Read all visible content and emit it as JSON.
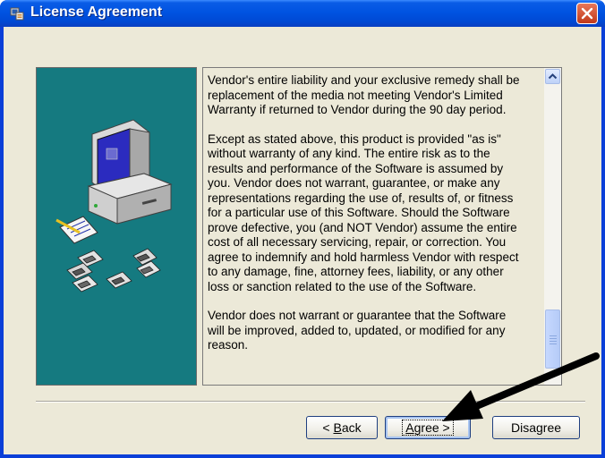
{
  "window": {
    "title": "License Agreement"
  },
  "license": {
    "paragraphs": [
      "Vendor's entire liability and your exclusive remedy shall be\nreplacement of the media not meeting Vendor's Limited\nWarranty if returned to Vendor during the 90 day period.",
      "Except as stated above, this product is provided \"as is\"\nwithout warranty of any kind.  The entire risk as to the\nresults and performance of the Software is assumed by\nyou.  Vendor does not warrant, guarantee, or make any\nrepresentations regarding the use of, results of, or fitness\nfor a particular use of this Software.  Should the Software\nprove defective, you (and NOT Vendor) assume the entire\ncost of all necessary servicing, repair, or correction.  You\nagree to indemnify and hold harmless Vendor with respect\nto any damage, fine, attorney fees, liability, or any other\nloss or sanction related to the use of the Software.",
      "Vendor does not warrant or guarantee that the Software\nwill be improved, added to, updated, or modified for any\nreason."
    ]
  },
  "buttons": {
    "back": {
      "prefix": "< ",
      "mnemonic": "B",
      "rest": "ack"
    },
    "agree": {
      "mnemonic": "A",
      "rest": "gree >"
    },
    "disagree": "Disagree"
  },
  "icons": {
    "title": "setup-icon",
    "close": "close-icon",
    "scroll_up": "chevron-up-icon",
    "illustration": "computer-with-disks-illustration",
    "annotation": "pointer-arrow"
  },
  "colors": {
    "titlebar": "#0053e1",
    "art_bg": "#157a80",
    "dialog_bg": "#ece9d8",
    "close": "#c1391a"
  }
}
